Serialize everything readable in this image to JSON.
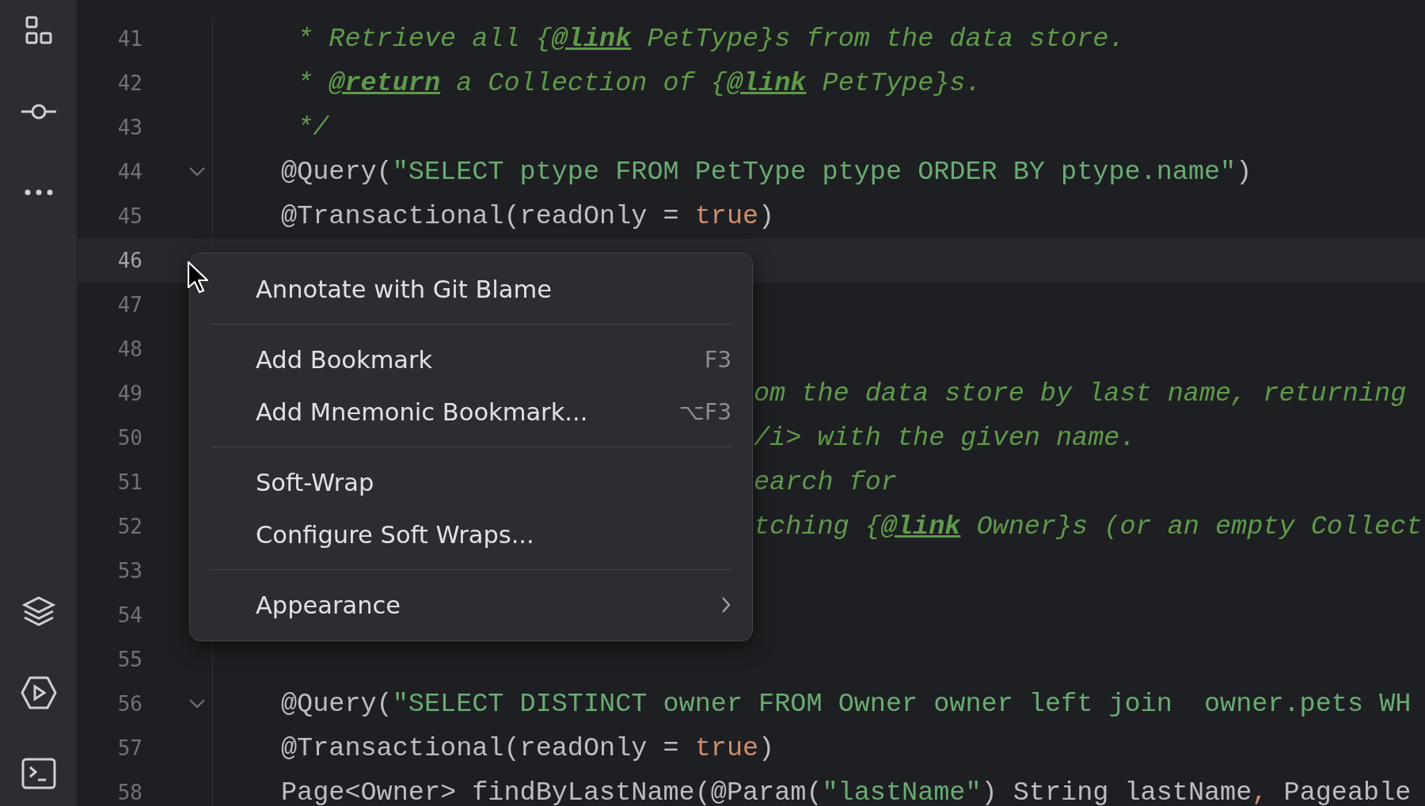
{
  "editor": {
    "lines": [
      {
        "number": "41",
        "kind": "code",
        "current": false,
        "foldable": false,
        "segments": [
          {
            "kind": "comment",
            "text": " * Retrieve all {"
          },
          {
            "kind": "doctag",
            "text": "@link"
          },
          {
            "kind": "comment",
            "text": " PetType}s from the data store."
          }
        ]
      },
      {
        "number": "42",
        "kind": "code",
        "current": false,
        "foldable": false,
        "segments": [
          {
            "kind": "comment",
            "text": " * "
          },
          {
            "kind": "doctag",
            "text": "@return"
          },
          {
            "kind": "comment",
            "text": " a Collection of {"
          },
          {
            "kind": "doctag",
            "text": "@link"
          },
          {
            "kind": "comment",
            "text": " PetType}s."
          }
        ]
      },
      {
        "number": "43",
        "kind": "code",
        "current": false,
        "foldable": false,
        "segments": [
          {
            "kind": "comment",
            "text": " */"
          }
        ]
      },
      {
        "number": "44",
        "kind": "code",
        "current": false,
        "foldable": true,
        "segments": [
          {
            "kind": "plain",
            "text": "@Query("
          },
          {
            "kind": "string",
            "text": "\"SELECT ptype FROM PetType ptype ORDER BY ptype.name\""
          },
          {
            "kind": "plain",
            "text": ")"
          }
        ]
      },
      {
        "number": "45",
        "kind": "code",
        "current": false,
        "foldable": false,
        "segments": [
          {
            "kind": "plain",
            "text": "@Transactional(readOnly = "
          },
          {
            "kind": "keyword",
            "text": "true"
          },
          {
            "kind": "plain",
            "text": ")"
          }
        ]
      },
      {
        "number": "46",
        "kind": "code",
        "current": true,
        "foldable": false
      },
      {
        "number": "47",
        "kind": "code",
        "current": false,
        "foldable": false
      },
      {
        "number": "48",
        "kind": "code",
        "current": false,
        "foldable": false
      },
      {
        "number": "49",
        "kind": "partial",
        "current": false,
        "foldable": false,
        "segments": [
          {
            "kind": "comment",
            "text": "om the data store by last name, returning"
          }
        ]
      },
      {
        "number": "50",
        "kind": "partial",
        "current": false,
        "foldable": false,
        "segments": [
          {
            "kind": "comment",
            "text": "/i> with the given name."
          }
        ]
      },
      {
        "number": "51",
        "kind": "partial",
        "current": false,
        "foldable": false,
        "segments": [
          {
            "kind": "comment",
            "text": "earch for"
          }
        ]
      },
      {
        "number": "52",
        "kind": "partial",
        "current": false,
        "foldable": false,
        "segments": [
          {
            "kind": "comment",
            "text": "tching {"
          },
          {
            "kind": "doctag",
            "text": "@link"
          },
          {
            "kind": "comment",
            "text": " Owner}s (or an empty Collect"
          }
        ]
      },
      {
        "number": "53",
        "kind": "code",
        "current": false,
        "foldable": false
      },
      {
        "number": "54",
        "kind": "code",
        "current": false,
        "foldable": false
      },
      {
        "number": "55",
        "kind": "code",
        "current": false,
        "foldable": false
      },
      {
        "number": "56",
        "kind": "code",
        "current": false,
        "foldable": true,
        "segments": [
          {
            "kind": "plain",
            "text": "@Query("
          },
          {
            "kind": "string",
            "text": "\"SELECT DISTINCT owner FROM Owner owner left join  owner.pets WH"
          }
        ]
      },
      {
        "number": "57",
        "kind": "code",
        "current": false,
        "foldable": false,
        "segments": [
          {
            "kind": "plain",
            "text": "@Transactional(readOnly = "
          },
          {
            "kind": "keyword",
            "text": "true"
          },
          {
            "kind": "plain",
            "text": ")"
          }
        ]
      },
      {
        "number": "58",
        "kind": "code",
        "current": false,
        "foldable": false,
        "segments": [
          {
            "kind": "plain",
            "text": "Page<Owner> findByLastName(@Param("
          },
          {
            "kind": "string",
            "text": "\"lastName\""
          },
          {
            "kind": "plain",
            "text": ") String lastName"
          },
          {
            "kind": "keyword",
            "text": ","
          },
          {
            "kind": "plain",
            "text": " Pageable"
          }
        ]
      }
    ]
  },
  "context_menu": {
    "items": [
      {
        "kind": "item",
        "label": "Annotate with Git Blame"
      },
      {
        "kind": "separator"
      },
      {
        "kind": "item",
        "label": "Add Bookmark",
        "shortcut": "F3"
      },
      {
        "kind": "item",
        "label": "Add Mnemonic Bookmark...",
        "shortcut": "⌥F3"
      },
      {
        "kind": "separator"
      },
      {
        "kind": "item",
        "label": "Soft-Wrap"
      },
      {
        "kind": "item",
        "label": "Configure Soft Wraps..."
      },
      {
        "kind": "separator"
      },
      {
        "kind": "submenu",
        "label": "Appearance"
      }
    ]
  }
}
